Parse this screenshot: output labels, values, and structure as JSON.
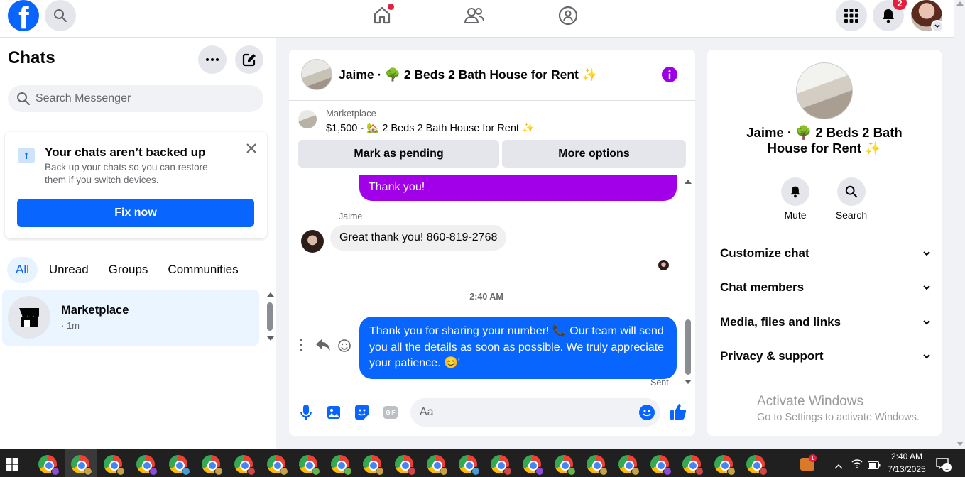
{
  "header": {
    "notification_count": "2",
    "brand_color": "#0866ff"
  },
  "sidebar": {
    "title": "Chats",
    "search_placeholder": "Search Messenger",
    "backup": {
      "title": "Your chats aren’t backed up",
      "body": "Back up your chats so you can restore them if you switch devices.",
      "button": "Fix now"
    },
    "tabs": [
      "All",
      "Unread",
      "Groups",
      "Communities"
    ],
    "chats": [
      {
        "name": "Marketplace",
        "meta": "· 1m"
      }
    ]
  },
  "conversation": {
    "title": "Jaime · 🌳 2 Beds 2 Bath House for Rent ✨",
    "listing": {
      "label": "Marketplace",
      "summary": "$1,500 - 🏡 2 Beds 2 Bath House for Rent ✨"
    },
    "actions": [
      "Mark as pending",
      "More options"
    ],
    "messages": [
      {
        "from": "me",
        "text": "Thank you!"
      },
      {
        "from": "Jaime",
        "sender_label": "Jaime",
        "text": "Great thank you! 860-819-2768"
      },
      {
        "type": "timestamp",
        "text": "2:40 AM"
      },
      {
        "from": "me",
        "text": "Thank you for sharing your number! 📞 Our team will send you all the details as soon as possible. We truly appreciate your patience. 😊'"
      }
    ],
    "status": "Sent",
    "composer_placeholder": "Aa"
  },
  "details": {
    "title": "Jaime · 🌳 2 Beds 2 Bath House for Rent ✨",
    "actions": [
      "Mute",
      "Search"
    ],
    "sections": [
      "Customize chat",
      "Chat members",
      "Media, files and links",
      "Privacy & support"
    ]
  },
  "watermark": {
    "title": "Activate Windows",
    "body": "Go to Settings to activate Windows."
  },
  "taskbar": {
    "time": "2:40 AM",
    "date": "7/13/2025",
    "notification_count": "1",
    "app_badge": "1"
  }
}
